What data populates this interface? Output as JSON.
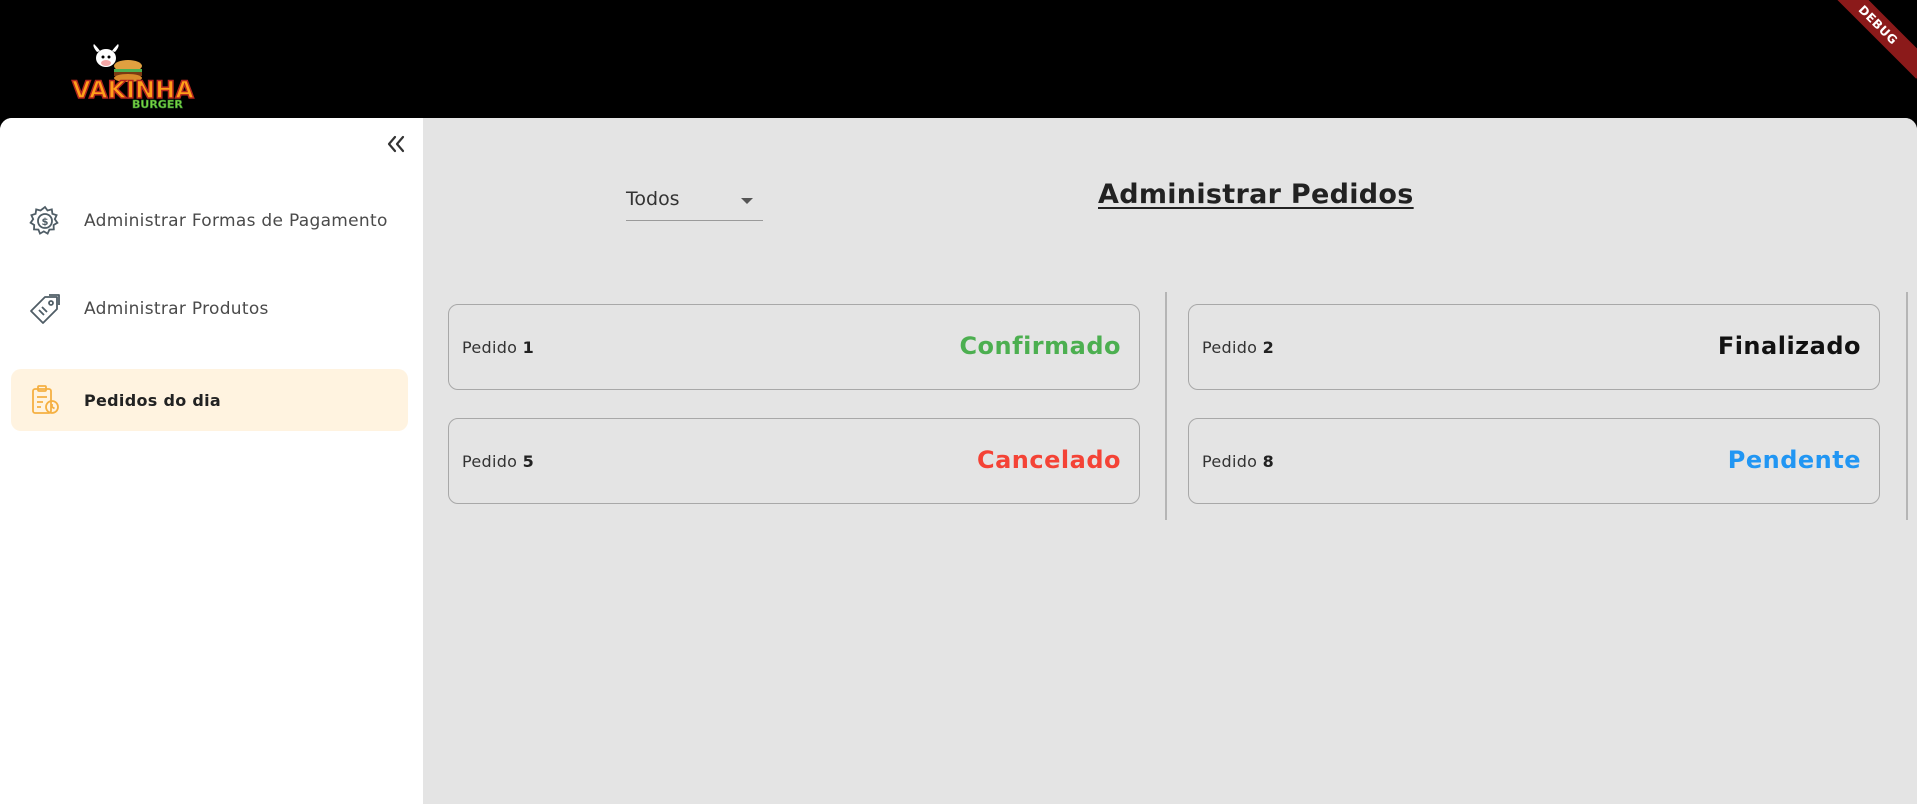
{
  "header": {
    "logo_main": "VAKINHA",
    "logo_sub": "BURGER",
    "debug_label": "DEBUG"
  },
  "sidebar": {
    "items": [
      {
        "label": "Administrar Formas de Pagamento",
        "icon": "payment-gear-icon",
        "active": false
      },
      {
        "label": "Administrar Produtos",
        "icon": "product-tag-icon",
        "active": false
      },
      {
        "label": "Pedidos do dia",
        "icon": "orders-clipboard-icon",
        "active": true
      }
    ]
  },
  "main": {
    "filter": {
      "selected": "Todos"
    },
    "title": "Administrar Pedidos",
    "orders": [
      {
        "prefix": "Pedido ",
        "number": "1",
        "status": "Confirmado",
        "status_color": "#4caf50"
      },
      {
        "prefix": "Pedido ",
        "number": "2",
        "status": "Finalizado",
        "status_color": "#111111"
      },
      {
        "prefix": "Pedido ",
        "number": "5",
        "status": "Cancelado",
        "status_color": "#f44336"
      },
      {
        "prefix": "Pedido ",
        "number": "8",
        "status": "Pendente",
        "status_color": "#2196f3"
      }
    ]
  },
  "colors": {
    "active_item_bg": "#fff3e0",
    "active_icon": "#f5b042",
    "content_bg": "#e4e4e4"
  }
}
